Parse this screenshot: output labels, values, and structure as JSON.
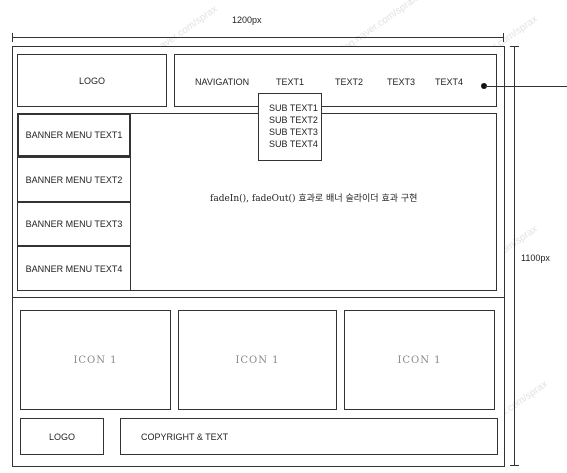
{
  "dimensions": {
    "width_label": "1200px",
    "height_label": "1100px"
  },
  "header": {
    "logo": "LOGO",
    "nav": [
      "NAVIGATION",
      "TEXT1",
      "TEXT2",
      "TEXT3",
      "TEXT4"
    ],
    "submenu": [
      "SUB TEXT1",
      "SUB TEXT2",
      "SUB TEXT3",
      "SUB TEXT4"
    ]
  },
  "banner": {
    "menu": [
      "BANNER MENU TEXT1",
      "BANNER MENU TEXT2",
      "BANNER MENU TEXT3",
      "BANNER MENU TEXT4"
    ],
    "description": "fadeIn(), fadeOut() 효과로 배너 슬라이더 효과 구현"
  },
  "icons": [
    "ICON 1",
    "ICON 1",
    "ICON 1"
  ],
  "footer": {
    "logo": "LOGO",
    "copyright": "COPYRIGHT & TEXT"
  },
  "watermark": "blog.naver.com/sprax"
}
